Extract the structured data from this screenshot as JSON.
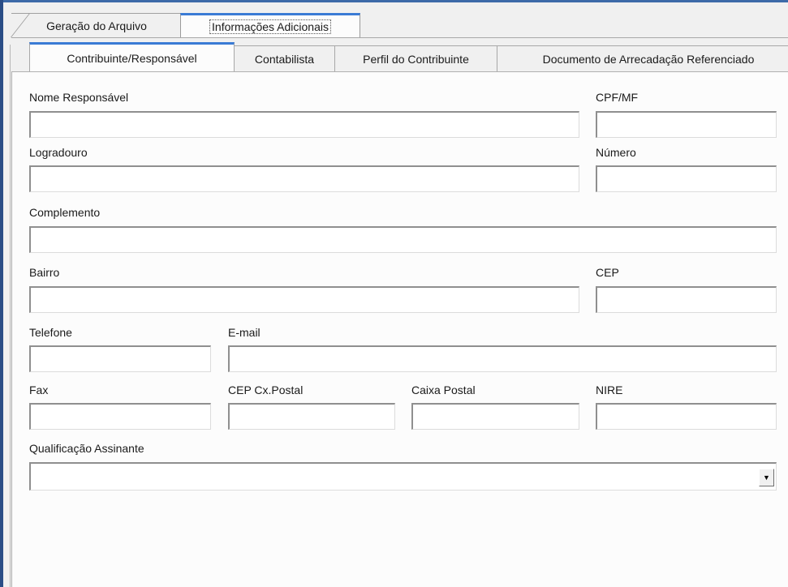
{
  "outer_tabs": [
    {
      "label": "Geração do Arquivo",
      "active": false
    },
    {
      "label": "Informações Adicionais",
      "active": true
    }
  ],
  "inner_tabs": [
    {
      "label": "Contribuinte/Responsável",
      "active": true
    },
    {
      "label": "Contabilista",
      "active": false
    },
    {
      "label": "Perfil do Contribuinte",
      "active": false
    },
    {
      "label": "Documento de Arrecadação Referenciado",
      "active": false
    }
  ],
  "form": {
    "nome_responsavel": {
      "label": "Nome Responsável",
      "value": ""
    },
    "cpf_mf": {
      "label": "CPF/MF",
      "value": ""
    },
    "logradouro": {
      "label": "Logradouro",
      "value": ""
    },
    "numero": {
      "label": "Número",
      "value": ""
    },
    "complemento": {
      "label": "Complemento",
      "value": ""
    },
    "bairro": {
      "label": "Bairro",
      "value": ""
    },
    "cep": {
      "label": "CEP",
      "value": ""
    },
    "telefone": {
      "label": "Telefone",
      "value": ""
    },
    "email": {
      "label": "E-mail",
      "value": ""
    },
    "fax": {
      "label": "Fax",
      "value": ""
    },
    "cep_cx_postal": {
      "label": "CEP Cx.Postal",
      "value": ""
    },
    "caixa_postal": {
      "label": "Caixa Postal",
      "value": ""
    },
    "nire": {
      "label": "NIRE",
      "value": ""
    },
    "qualificacao_assinante": {
      "label": "Qualificação Assinante",
      "value": "",
      "dropdown_icon": "▼"
    }
  },
  "colors": {
    "active_tab_accent": "#3a7bd5",
    "window_frame": "#2a4d86"
  }
}
